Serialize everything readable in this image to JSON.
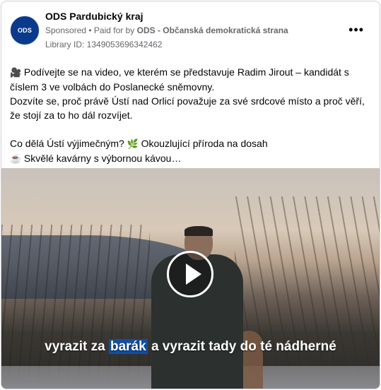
{
  "post": {
    "page_name": "ODS Pardubický kraj",
    "avatar_text": "ODS",
    "sponsored": "Sponsored",
    "paid_for_prefix": " • Paid for by ",
    "paid_for_by": "ODS - Občanská demokratická strana",
    "library_id": "Library ID: 1349053696342462",
    "more_label": "•••",
    "body": {
      "emoji_camera": "🎥",
      "line1": "Podívejte se na video, ve kterém se představuje Radim Jirout – kandidát s číslem 3 ve volbách do Poslanecké sněmovny.",
      "line2": "Dozvíte se, proč právě Ústí nad Orlicí považuje za své srdcové místo a proč věří, že stojí za to ho dál rozvíjet.",
      "line3_a": "Co dělá Ústí výjimečným?",
      "emoji_plant": "🌿",
      "line3_b": "Okouzlující příroda na dosah",
      "emoji_coffee": "☕",
      "line4": "Skvělé kavárny s výbornou kávou…"
    }
  },
  "video": {
    "caption_before": "vyrazit za ",
    "caption_highlight": "barák",
    "caption_after": " a vyrazit tady do té nádherné",
    "play_icon": "play-icon"
  }
}
